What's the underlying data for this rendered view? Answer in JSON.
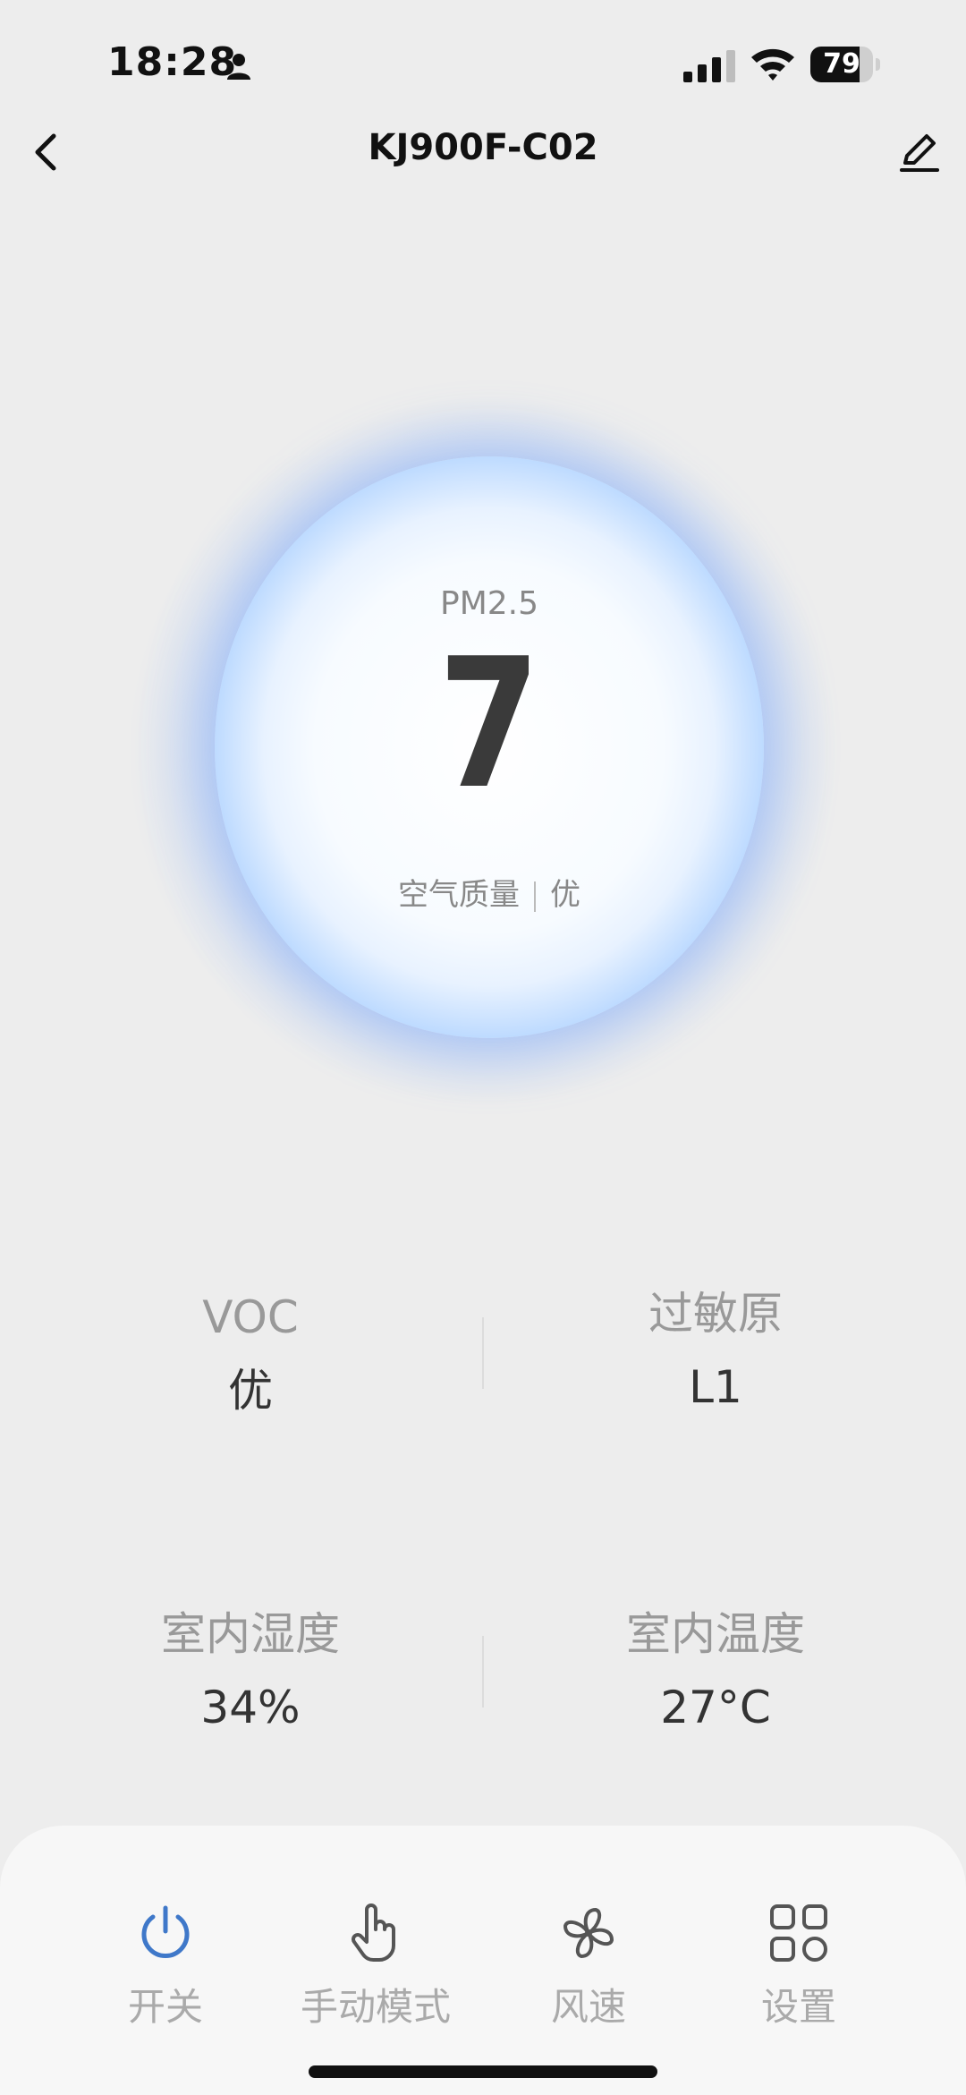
{
  "status_bar": {
    "time": "18:28",
    "battery": "79",
    "battery_level": 0.79
  },
  "header": {
    "title": "KJ900F-C02"
  },
  "main": {
    "pm_label": "PM2.5",
    "pm_value": "7",
    "air_quality_label": "空气质量",
    "air_quality_value": "优"
  },
  "stats": {
    "voc": {
      "label": "VOC",
      "value": "优"
    },
    "allergen": {
      "label": "过敏原",
      "value": "L1"
    },
    "humidity": {
      "label": "室内湿度",
      "value": "34%"
    },
    "temperature": {
      "label": "室内温度",
      "value": "27°C"
    }
  },
  "actions": [
    {
      "label": "开关",
      "icon": "power-icon",
      "color": "#3f78c9"
    },
    {
      "label": "手动模式",
      "icon": "hand-pointer-icon",
      "color": "#555555"
    },
    {
      "label": "风速",
      "icon": "fan-icon",
      "color": "#555555"
    },
    {
      "label": "设置",
      "icon": "grid-settings-icon",
      "color": "#555555"
    }
  ]
}
